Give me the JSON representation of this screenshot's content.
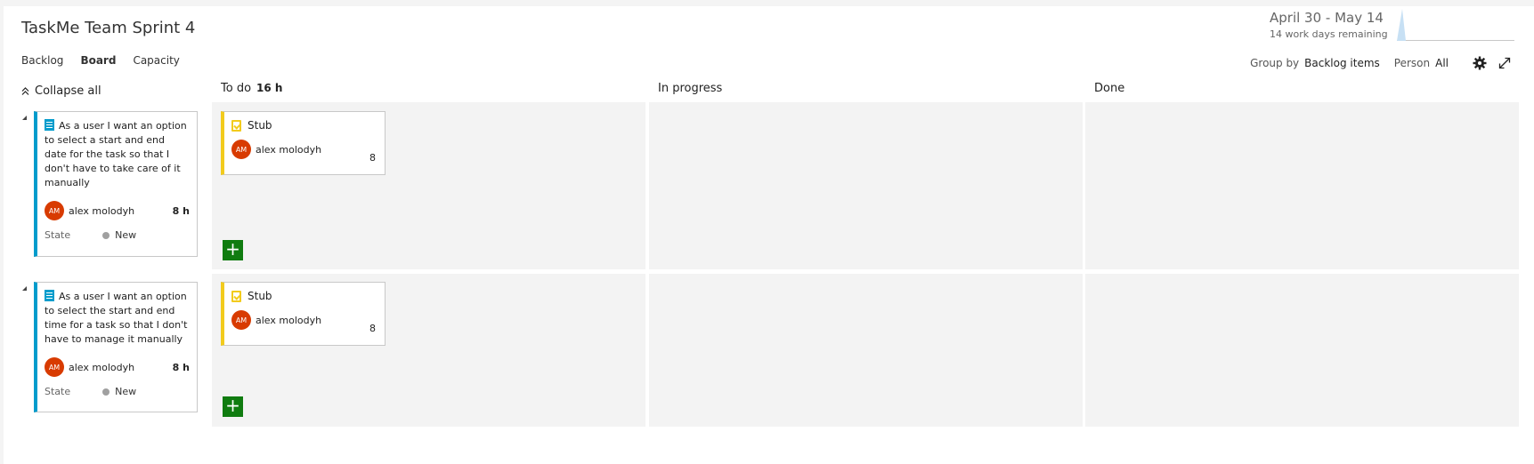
{
  "header": {
    "title": "TaskMe Team Sprint 4",
    "tabs": [
      {
        "label": "Backlog"
      },
      {
        "label": "Board"
      },
      {
        "label": "Capacity"
      }
    ],
    "dates": "April 30 - May 14",
    "remaining": "14 work days remaining"
  },
  "toolbar": {
    "group_by_label": "Group by",
    "group_by_value": "Backlog items",
    "person_label": "Person",
    "person_value": "All",
    "settings_icon": "gear-icon",
    "fullscreen_icon": "expand-icon"
  },
  "board": {
    "collapse_all": "Collapse all",
    "columns": [
      {
        "name": "To do",
        "count": "16 h"
      },
      {
        "name": "In progress",
        "count": ""
      },
      {
        "name": "Done",
        "count": ""
      }
    ],
    "rows": [
      {
        "backlog_item": {
          "title": "As a user I want an option to select a start and end date for the task so that I don't have to take care of it manually",
          "assignee_initials": "AM",
          "assignee": "alex molodyh",
          "estimate": "8 h",
          "state_label": "State",
          "state": "New"
        },
        "task": {
          "title": "Stub",
          "assignee_initials": "AM",
          "assignee": "alex molodyh",
          "remaining": "8"
        }
      },
      {
        "backlog_item": {
          "title": "As a user I want an option to select the start and end time for a task so that I don't have to manage it manually",
          "assignee_initials": "AM",
          "assignee": "alex molodyh",
          "estimate": "8 h",
          "state_label": "State",
          "state": "New"
        },
        "task": {
          "title": "Stub",
          "assignee_initials": "AM",
          "assignee": "alex molodyh",
          "remaining": "8"
        }
      }
    ],
    "add_label": "+"
  },
  "colors": {
    "accent_pbi": "#009ccc",
    "accent_task": "#f2cb1d",
    "avatar": "#d83b01",
    "add_button": "#107c10"
  }
}
